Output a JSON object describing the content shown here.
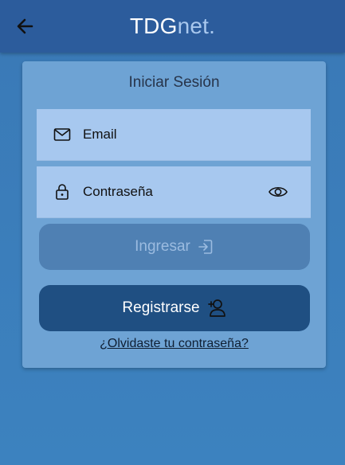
{
  "header": {
    "brand_main": "TDG",
    "brand_suffix": "net.",
    "back_icon": "arrow-left-icon"
  },
  "login_card": {
    "title": "Iniciar Sesión",
    "email_label": "Email",
    "email_icon": "mail-icon",
    "password_label": "Contraseña",
    "password_icon": "lock-icon",
    "toggle_icon": "eye-icon",
    "login_button": "Ingresar",
    "login_icon": "login-arrow-icon",
    "register_button": "Registrarse",
    "register_icon": "user-add-icon",
    "forgot_link": "¿Olvidaste tu contraseña?"
  },
  "colors": {
    "header": "#2c5c9c",
    "background": "#3a79b6",
    "card": "#6ea3d4",
    "field": "#a7c8ef",
    "login_button": "#4f80b3",
    "register_button": "#1f4f82"
  }
}
